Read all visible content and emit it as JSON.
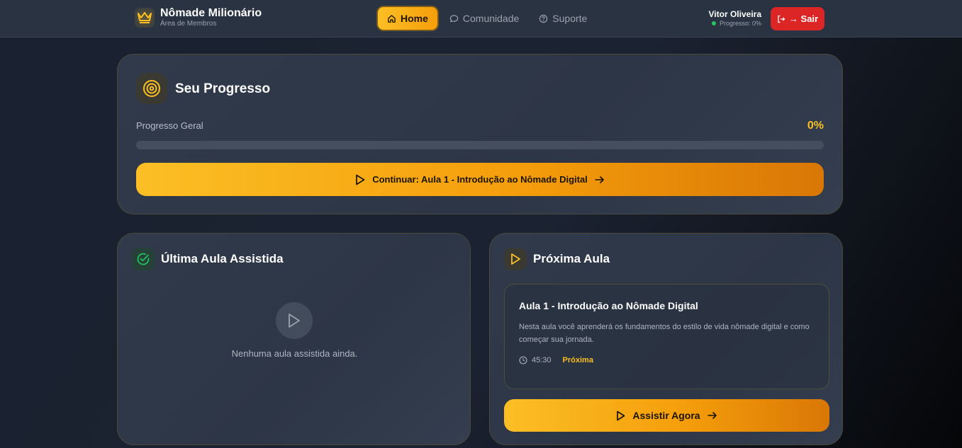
{
  "header": {
    "brand_title": "Nômade Milionário",
    "brand_subtitle": "Área de Membros",
    "nav": [
      {
        "label": "Home",
        "icon": "home-icon",
        "active": true
      },
      {
        "label": "Comunidade",
        "icon": "chat-icon"
      },
      {
        "label": "Suporte",
        "icon": "help-circle-icon"
      }
    ],
    "user_name": "Vitor Oliveira",
    "user_progress": "Progresso: 0%",
    "logout_label": "→ Sair"
  },
  "progress": {
    "title": "Seu Progresso",
    "label": "Progresso Geral",
    "value_text": "0%",
    "value": 0,
    "continue_label": "Continuar: Aula 1 - Introdução ao Nômade Digital"
  },
  "last_lesson": {
    "title": "Última Aula Assistida",
    "empty_text": "Nenhuma aula assistida ainda."
  },
  "next_lesson": {
    "title": "Próxima Aula",
    "lesson_title": "Aula 1 - Introdução ao Nômade Digital",
    "description": "Nesta aula você aprenderá os fundamentos do estilo de vida nômade digital e como começar sua jornada.",
    "duration": "45:30",
    "badge": "Próxima",
    "watch_label": "Assistir Agora"
  },
  "colors": {
    "accent": "#fbbf24",
    "danger": "#dc2626",
    "success": "#22c55e"
  }
}
